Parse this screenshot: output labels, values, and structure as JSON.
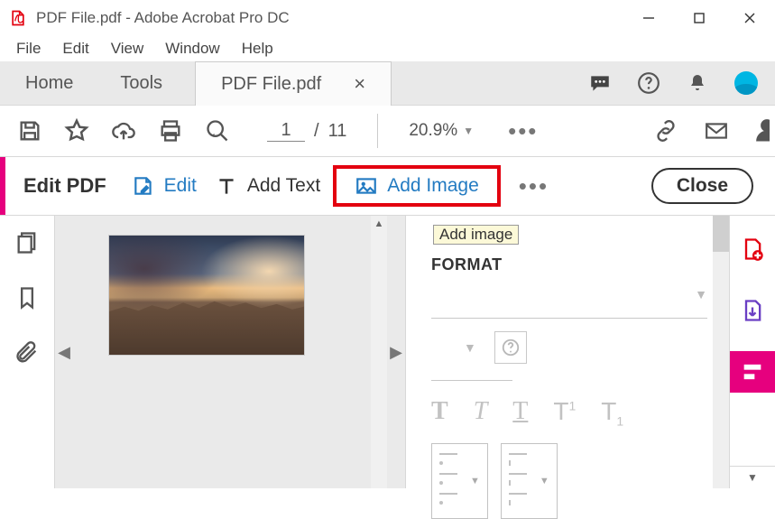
{
  "window": {
    "title": "PDF File.pdf - Adobe Acrobat Pro DC"
  },
  "menubar": [
    "File",
    "Edit",
    "View",
    "Window",
    "Help"
  ],
  "doc_tabs": {
    "home": "Home",
    "tools": "Tools",
    "active": "PDF File.pdf"
  },
  "toolbar": {
    "page_current": "1",
    "page_separator": "/",
    "page_total": "11",
    "zoom": "20.9%"
  },
  "editbar": {
    "title": "Edit PDF",
    "edit": "Edit",
    "add_text": "Add Text",
    "add_image": "Add Image",
    "close": "Close"
  },
  "tooltip": "Add image",
  "format_panel": {
    "heading": "FORMAT"
  }
}
